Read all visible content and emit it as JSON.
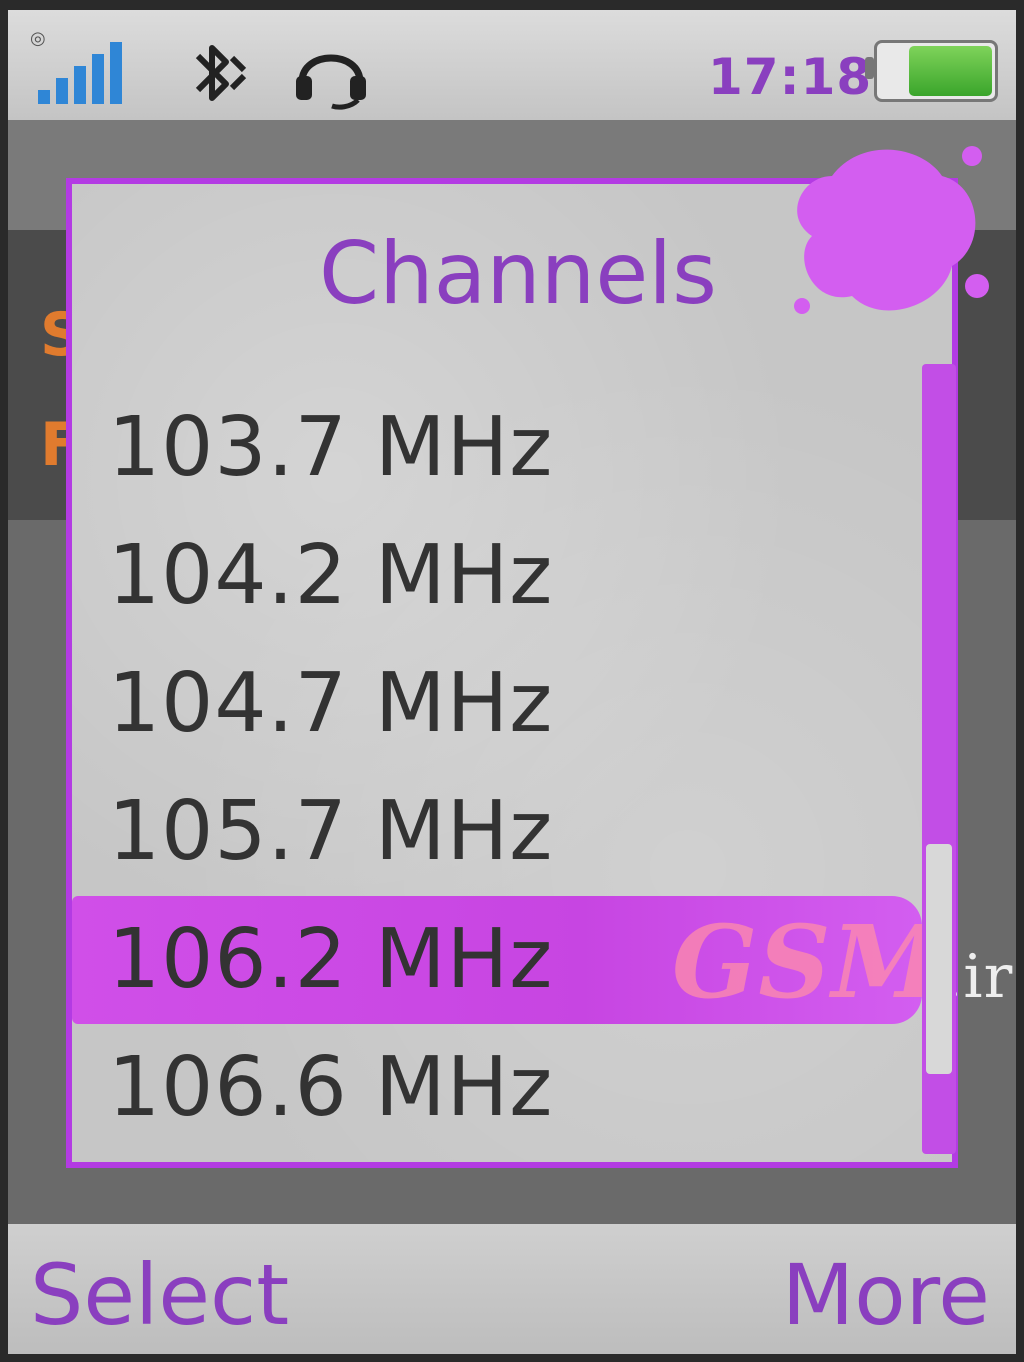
{
  "status_bar": {
    "time": "17:18",
    "icons": [
      "signal-icon",
      "bluetooth-icon",
      "headset-icon",
      "battery-icon"
    ],
    "battery_level": 0.7
  },
  "popup": {
    "title": "Channels",
    "channels": [
      "103.7 MHz",
      "104.2 MHz",
      "104.7 MHz",
      "105.7 MHz",
      "106.2 MHz",
      "106.6 MHz"
    ],
    "selected_index": 4
  },
  "watermark": {
    "text": "GSM",
    "suffix": ".ir"
  },
  "softkeys": {
    "left": "Select",
    "right": "More"
  },
  "colors": {
    "accent": "#8a3fbf",
    "highlight": "#c745e2",
    "battery": "#3aa52b",
    "signal": "#2f86d6"
  }
}
